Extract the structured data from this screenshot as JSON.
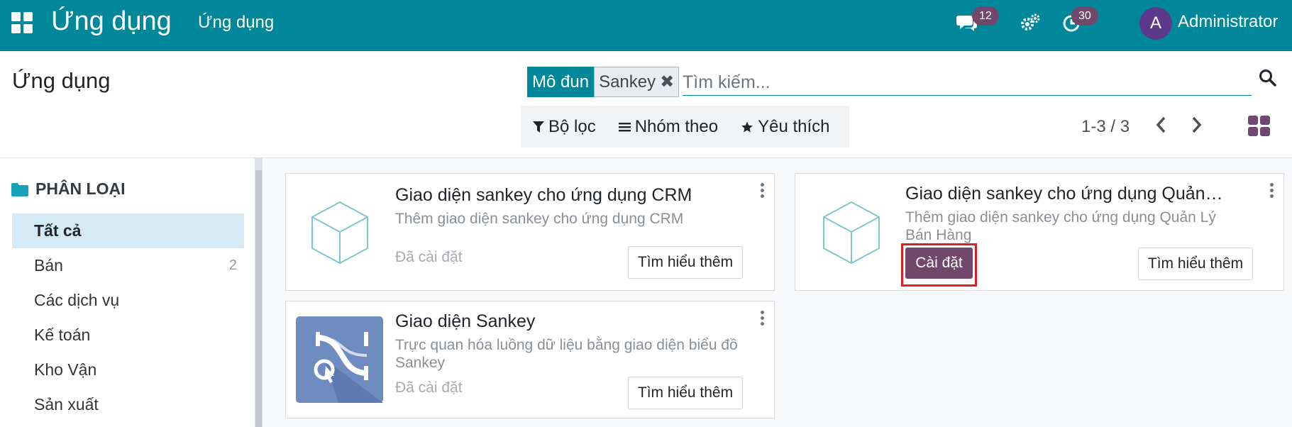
{
  "navbar": {
    "brand": "Ứng dụng",
    "menu": "Ứng dụng",
    "messages_count": "12",
    "activities_count": "30",
    "avatar_letter": "A",
    "user_name": "Administrator",
    "color": "#00889a"
  },
  "control": {
    "title": "Ứng dụng",
    "facet_label": "Mô đun",
    "facet_value": "Sankey",
    "search_placeholder": "Tìm kiếm...",
    "filter_label": "Bộ lọc",
    "group_label": "Nhóm theo",
    "favorites_label": "Yêu thích",
    "pager": "1-3 / 3"
  },
  "sidebar": {
    "heading": "PHÂN LOẠI",
    "items": [
      {
        "label": "Tất cả",
        "count": "",
        "active": true
      },
      {
        "label": "Bán",
        "count": "2"
      },
      {
        "label": "Các dịch vụ",
        "count": ""
      },
      {
        "label": "Kế toán",
        "count": ""
      },
      {
        "label": "Kho Vận",
        "count": ""
      },
      {
        "label": "Sản xuất",
        "count": ""
      }
    ]
  },
  "cards": [
    {
      "title": "Giao diện sankey cho ứng dụng CRM",
      "description": "Thêm giao diện sankey cho ứng dụng CRM",
      "status": "Đã cài đặt",
      "learn_label": "Tìm hiểu thêm",
      "icon": "cube-icon"
    },
    {
      "title": "Giao diện sankey cho ứng dụng Quản Lý Bán Hàng",
      "description": "Thêm giao diện sankey cho ứng dụng Quản Lý Bán Hàng",
      "install_label": "Cài đặt",
      "learn_label": "Tìm hiểu thêm",
      "icon": "cube-icon"
    },
    {
      "title": "Giao diện Sankey",
      "description": "Trực quan hóa luồng dữ liệu bằng giao diện biểu đồ Sankey",
      "status": "Đã cài đặt",
      "learn_label": "Tìm hiểu thêm",
      "icon": "sankey-app-icon"
    }
  ],
  "colors": {
    "primary": "#71476b",
    "teal": "#00889a",
    "highlight": "#e02020"
  }
}
